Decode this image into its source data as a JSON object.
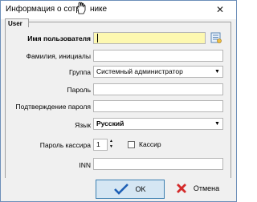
{
  "window": {
    "title_prefix": "Информация о сотр",
    "title_suffix": "нике",
    "close_glyph": "✕"
  },
  "group": {
    "title": "User"
  },
  "form": {
    "username_label": "Имя пользователя",
    "username_value": "",
    "fullname_label": "Фамилия, инициалы",
    "fullname_value": "",
    "group_label": "Группа",
    "group_value": "Системный администратор",
    "password_label": "Пароль",
    "password_value": "",
    "confirm_label": "Подтверждение пароля",
    "confirm_value": "",
    "language_label": "Язык",
    "language_value": "Русский",
    "cashier_pw_label": "Пароль кассира",
    "cashier_pw_value": "1",
    "cashier_label": "Кассир",
    "cashier_checked": false,
    "inn_label": "INN",
    "inn_value": ""
  },
  "buttons": {
    "ok_label": "OK",
    "cancel_label": "Отмена"
  },
  "colors": {
    "username_bg": "#fdf8b0",
    "ok_check": "#1e5fb5",
    "cancel_x": "#d42a2a"
  }
}
